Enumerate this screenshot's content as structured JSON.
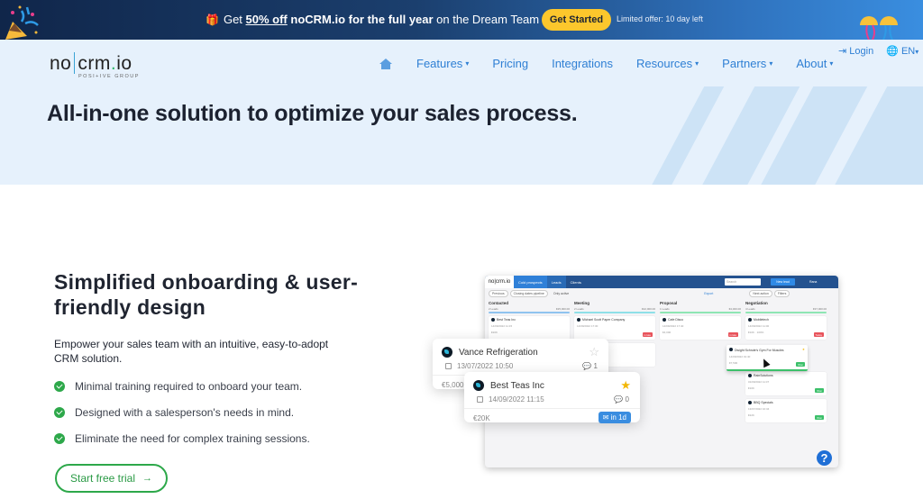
{
  "promo": {
    "text_before": "Get ",
    "discount": "50% off",
    "product": "noCRM.io for the full year",
    "text_after": " on the Dream Team Edition",
    "cta": "Get Started",
    "limited": "Limited offer: 10 day left",
    "gift_icon": "gift-icon"
  },
  "header": {
    "logo_left": "no",
    "logo_right": "crm",
    "logo_dot": ".",
    "logo_tld": "io",
    "logo_sub": "POSI+IVE GROUP",
    "nav": [
      {
        "label": "Features",
        "dropdown": true
      },
      {
        "label": "Pricing",
        "dropdown": false
      },
      {
        "label": "Integrations",
        "dropdown": false
      },
      {
        "label": "Resources",
        "dropdown": true
      },
      {
        "label": "Partners",
        "dropdown": true
      },
      {
        "label": "About",
        "dropdown": true
      }
    ],
    "caret": "▾",
    "login": "Login",
    "language": "EN"
  },
  "hero": {
    "title": "All-in-one solution to optimize your sales process."
  },
  "feature": {
    "title": "Simplified onboarding & user-friendly design",
    "description": "Empower your sales team with an intuitive, easy-to-adopt CRM solution.",
    "bullets": [
      "Minimal training required to onboard your team.",
      "Designed with a salesperson's needs in mind.",
      "Eliminate the need for complex training sessions."
    ],
    "cta": "Start free trial",
    "cta_arrow": "→"
  },
  "app": {
    "logo": "no|crm.io",
    "tabs": [
      "Cold prospects",
      "Leads",
      "Clients"
    ],
    "search_placeholder": "Search",
    "new_lead": "New lead",
    "user": "Rana",
    "filters": [
      "Previous",
      "Closing dates pipeline"
    ],
    "only_active": "Only active",
    "export": "Export",
    "next_action": "Next action",
    "filters_btn": "Filters",
    "columns": [
      {
        "name": "Contacted",
        "count": "2 Leads",
        "total": "€25,000.00",
        "color": "#8fc3ef",
        "cards": [
          {
            "name": "Best Teas Inc",
            "date": "14/09/2022 11:15",
            "value": "€20K"
          }
        ]
      },
      {
        "name": "Meeting",
        "count": "2 Leads",
        "total": "€22,000.00",
        "color": "#8ee0e8",
        "cards": [
          {
            "name": "Michael Scott Paper Company",
            "date": "14/09/2022 17:30",
            "value": "",
            "badge": "in late",
            "badge_color": "#e8535b"
          },
          {
            "name": "Solutions",
            "date": "",
            "value": ""
          }
        ]
      },
      {
        "name": "Proposal",
        "count": "1 Leads",
        "total": "€4,000.00",
        "color": "#8ee6b4",
        "cards": [
          {
            "name": "Cafe Disco",
            "date": "14/09/2022 17:40",
            "value": "€4,000",
            "badge": "in late",
            "badge_color": "#e8535b"
          }
        ]
      },
      {
        "name": "Negotiation",
        "count": "4 Leads",
        "total": "€37,000.00",
        "color": "#8ee6b4",
        "cards": [
          {
            "name": "Mobiletech",
            "date": "14/09/2022 11:00",
            "value": "€10K · 100%",
            "badge": "Today",
            "badge_color": "#e8535b"
          },
          {
            "name": "RainSolutions",
            "date": "01/09/2022 11:07",
            "value": "€10K",
            "badge": "Won",
            "badge_color": "#3cc06a"
          },
          {
            "name": "BBQ Specials",
            "date": "13/07/2022 10:34",
            "value": "€22K",
            "badge": "Won",
            "badge_color": "#3cc06a"
          }
        ]
      }
    ],
    "dragging_card": {
      "name": "Dwight Schrute's Gym For Muscles",
      "date": "14/09/2022 01:40",
      "value": "€7,500",
      "badge": "Won"
    }
  },
  "floating_cards": [
    {
      "name": "Vance Refrigeration",
      "date": "13/07/2022 10:50",
      "comments": "1",
      "value": "€5,000",
      "starred": false
    },
    {
      "name": "Best Teas Inc",
      "date": "14/09/2022 11:15",
      "comments": "0",
      "value": "€20K",
      "starred": true,
      "badge": "in 1d"
    }
  ],
  "help_label": "?",
  "colors": {
    "accent_blue": "#2e7fd4",
    "accent_green": "#2da84a",
    "promo_yellow": "#fcc72c",
    "hero_bg": "#e6f1fc"
  }
}
